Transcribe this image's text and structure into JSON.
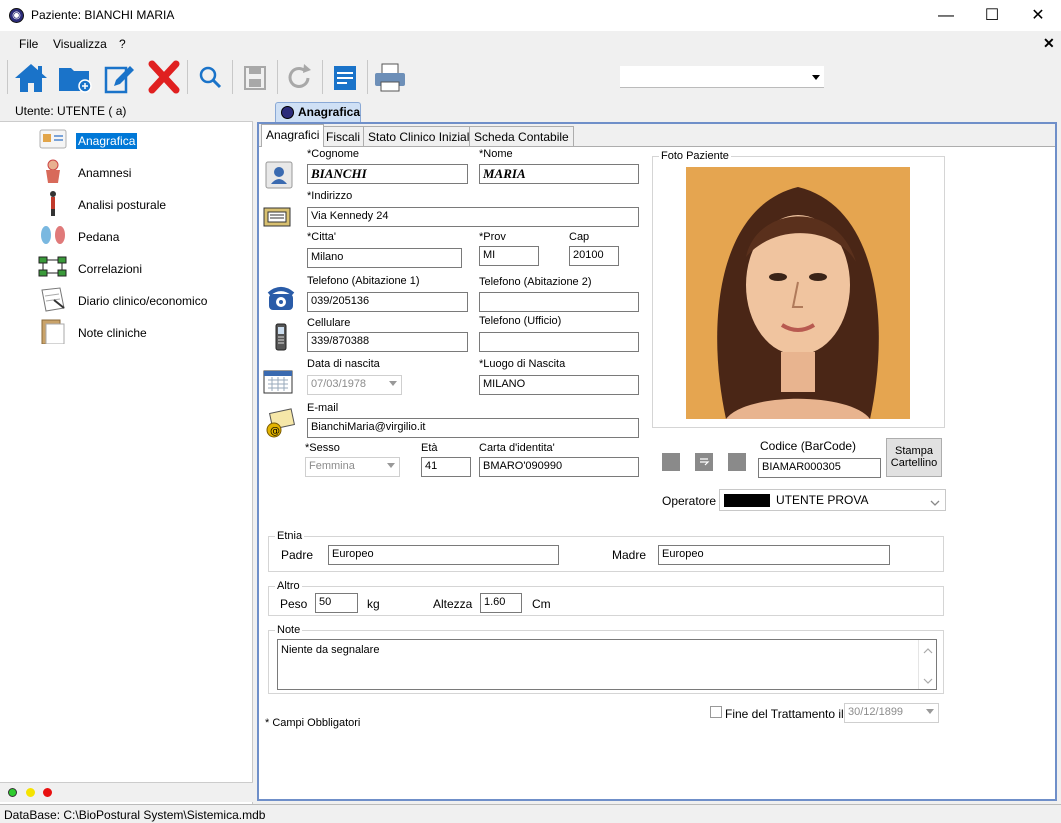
{
  "window": {
    "title": "Paziente: BIANCHI  MARIA"
  },
  "menu": {
    "file": "File",
    "visualizza": "Visualizza",
    "help": "?"
  },
  "toolbar": {
    "icons": [
      "home-icon",
      "folder-add-icon",
      "edit-icon",
      "delete-icon",
      "search-icon",
      "save-icon",
      "redo-icon",
      "list-icon",
      "print-icon"
    ],
    "combo_value": ""
  },
  "sidebar": {
    "user_label": "Utente: UTENTE ( a)",
    "items": [
      {
        "label": "Anagrafica",
        "icon": "id-card-icon",
        "selected": true
      },
      {
        "label": "Anamnesi",
        "icon": "anatomy-icon",
        "selected": false
      },
      {
        "label": "Analisi posturale",
        "icon": "posture-icon",
        "selected": false
      },
      {
        "label": "Pedana",
        "icon": "footprint-icon",
        "selected": false
      },
      {
        "label": "Correlazioni",
        "icon": "network-icon",
        "selected": false
      },
      {
        "label": "Diario clinico/economico",
        "icon": "notebook-icon",
        "selected": false
      },
      {
        "label": "Note cliniche",
        "icon": "clipboard-icon",
        "selected": false
      }
    ]
  },
  "main_tab": "Anagrafica",
  "subtabs": [
    "Anagrafici",
    "Fiscali",
    "Stato Clinico Iniziale",
    "Scheda Contabile"
  ],
  "form": {
    "cognome": {
      "label": "*Cognome",
      "value": "BIANCHI"
    },
    "nome": {
      "label": "*Nome",
      "value": "MARIA"
    },
    "indirizzo": {
      "label": "*Indirizzo",
      "value": "Via Kennedy 24"
    },
    "citta": {
      "label": "*Citta'",
      "value": "Milano"
    },
    "prov": {
      "label": "*Prov",
      "value": "MI"
    },
    "cap": {
      "label": "Cap",
      "value": "20100"
    },
    "tel_abit1": {
      "label": "Telefono (Abitazione 1)",
      "value": "039/205136"
    },
    "tel_abit2": {
      "label": "Telefono (Abitazione 2)",
      "value": ""
    },
    "cellulare": {
      "label": "Cellulare",
      "value": "339/870388"
    },
    "tel_ufficio": {
      "label": "Telefono (Ufficio)",
      "value": ""
    },
    "data_nascita": {
      "label": "Data di nascita",
      "value": "07/03/1978"
    },
    "luogo_nascita": {
      "label": "*Luogo di Nascita",
      "value": "MILANO"
    },
    "email": {
      "label": "E-mail",
      "value": "BianchiMaria@virgilio.it"
    },
    "sesso": {
      "label": "*Sesso",
      "value": "Femmina"
    },
    "eta": {
      "label": "Età",
      "value": "41"
    },
    "carta_identita": {
      "label": "Carta d'identita'",
      "value": "BMARO'090990"
    }
  },
  "photo": {
    "label": "Foto Paziente"
  },
  "barcode": {
    "label": "Codice (BarCode)",
    "value": "BIAMAR000305"
  },
  "stampa_button": {
    "line1": "Stampa",
    "line2": "Cartellino"
  },
  "operatore": {
    "label": "Operatore",
    "value": "UTENTE PROVA"
  },
  "etnia": {
    "title": "Etnia",
    "padre_label": "Padre",
    "padre_value": "Europeo",
    "madre_label": "Madre",
    "madre_value": "Europeo"
  },
  "altro": {
    "title": "Altro",
    "peso_label": "Peso",
    "peso_value": "50",
    "peso_unit": "kg",
    "altezza_label": "Altezza",
    "altezza_value": "1.60",
    "altezza_unit": "Cm"
  },
  "note": {
    "title": "Note",
    "value": "Niente da segnalare"
  },
  "required_note": "* Campi Obbligatori",
  "fine_trattamento": {
    "label": "Fine del Trattamento il :",
    "value": "30/12/1899",
    "checked": false
  },
  "status": {
    "database": "DataBase: C:\\BioPostural System\\Sistemica.mdb"
  },
  "colors": {
    "accent": "#0078d7",
    "frame": "#6f8fc9"
  }
}
